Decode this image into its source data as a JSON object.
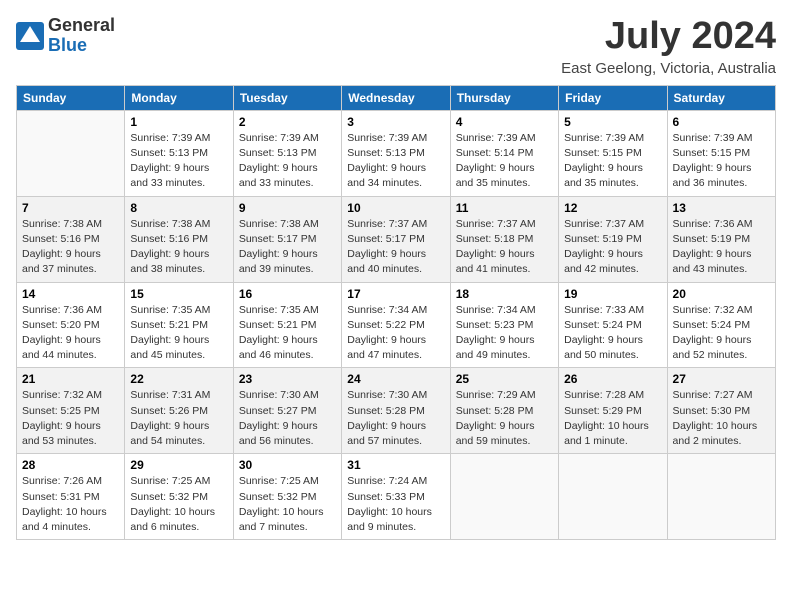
{
  "header": {
    "logo_line1": "General",
    "logo_line2": "Blue",
    "month_year": "July 2024",
    "location": "East Geelong, Victoria, Australia"
  },
  "days_of_week": [
    "Sunday",
    "Monday",
    "Tuesday",
    "Wednesday",
    "Thursday",
    "Friday",
    "Saturday"
  ],
  "weeks": [
    [
      {
        "day": "",
        "info": ""
      },
      {
        "day": "1",
        "info": "Sunrise: 7:39 AM\nSunset: 5:13 PM\nDaylight: 9 hours\nand 33 minutes."
      },
      {
        "day": "2",
        "info": "Sunrise: 7:39 AM\nSunset: 5:13 PM\nDaylight: 9 hours\nand 33 minutes."
      },
      {
        "day": "3",
        "info": "Sunrise: 7:39 AM\nSunset: 5:13 PM\nDaylight: 9 hours\nand 34 minutes."
      },
      {
        "day": "4",
        "info": "Sunrise: 7:39 AM\nSunset: 5:14 PM\nDaylight: 9 hours\nand 35 minutes."
      },
      {
        "day": "5",
        "info": "Sunrise: 7:39 AM\nSunset: 5:15 PM\nDaylight: 9 hours\nand 35 minutes."
      },
      {
        "day": "6",
        "info": "Sunrise: 7:39 AM\nSunset: 5:15 PM\nDaylight: 9 hours\nand 36 minutes."
      }
    ],
    [
      {
        "day": "7",
        "info": "Sunrise: 7:38 AM\nSunset: 5:16 PM\nDaylight: 9 hours\nand 37 minutes."
      },
      {
        "day": "8",
        "info": "Sunrise: 7:38 AM\nSunset: 5:16 PM\nDaylight: 9 hours\nand 38 minutes."
      },
      {
        "day": "9",
        "info": "Sunrise: 7:38 AM\nSunset: 5:17 PM\nDaylight: 9 hours\nand 39 minutes."
      },
      {
        "day": "10",
        "info": "Sunrise: 7:37 AM\nSunset: 5:17 PM\nDaylight: 9 hours\nand 40 minutes."
      },
      {
        "day": "11",
        "info": "Sunrise: 7:37 AM\nSunset: 5:18 PM\nDaylight: 9 hours\nand 41 minutes."
      },
      {
        "day": "12",
        "info": "Sunrise: 7:37 AM\nSunset: 5:19 PM\nDaylight: 9 hours\nand 42 minutes."
      },
      {
        "day": "13",
        "info": "Sunrise: 7:36 AM\nSunset: 5:19 PM\nDaylight: 9 hours\nand 43 minutes."
      }
    ],
    [
      {
        "day": "14",
        "info": "Sunrise: 7:36 AM\nSunset: 5:20 PM\nDaylight: 9 hours\nand 44 minutes."
      },
      {
        "day": "15",
        "info": "Sunrise: 7:35 AM\nSunset: 5:21 PM\nDaylight: 9 hours\nand 45 minutes."
      },
      {
        "day": "16",
        "info": "Sunrise: 7:35 AM\nSunset: 5:21 PM\nDaylight: 9 hours\nand 46 minutes."
      },
      {
        "day": "17",
        "info": "Sunrise: 7:34 AM\nSunset: 5:22 PM\nDaylight: 9 hours\nand 47 minutes."
      },
      {
        "day": "18",
        "info": "Sunrise: 7:34 AM\nSunset: 5:23 PM\nDaylight: 9 hours\nand 49 minutes."
      },
      {
        "day": "19",
        "info": "Sunrise: 7:33 AM\nSunset: 5:24 PM\nDaylight: 9 hours\nand 50 minutes."
      },
      {
        "day": "20",
        "info": "Sunrise: 7:32 AM\nSunset: 5:24 PM\nDaylight: 9 hours\nand 52 minutes."
      }
    ],
    [
      {
        "day": "21",
        "info": "Sunrise: 7:32 AM\nSunset: 5:25 PM\nDaylight: 9 hours\nand 53 minutes."
      },
      {
        "day": "22",
        "info": "Sunrise: 7:31 AM\nSunset: 5:26 PM\nDaylight: 9 hours\nand 54 minutes."
      },
      {
        "day": "23",
        "info": "Sunrise: 7:30 AM\nSunset: 5:27 PM\nDaylight: 9 hours\nand 56 minutes."
      },
      {
        "day": "24",
        "info": "Sunrise: 7:30 AM\nSunset: 5:28 PM\nDaylight: 9 hours\nand 57 minutes."
      },
      {
        "day": "25",
        "info": "Sunrise: 7:29 AM\nSunset: 5:28 PM\nDaylight: 9 hours\nand 59 minutes."
      },
      {
        "day": "26",
        "info": "Sunrise: 7:28 AM\nSunset: 5:29 PM\nDaylight: 10 hours\nand 1 minute."
      },
      {
        "day": "27",
        "info": "Sunrise: 7:27 AM\nSunset: 5:30 PM\nDaylight: 10 hours\nand 2 minutes."
      }
    ],
    [
      {
        "day": "28",
        "info": "Sunrise: 7:26 AM\nSunset: 5:31 PM\nDaylight: 10 hours\nand 4 minutes."
      },
      {
        "day": "29",
        "info": "Sunrise: 7:25 AM\nSunset: 5:32 PM\nDaylight: 10 hours\nand 6 minutes."
      },
      {
        "day": "30",
        "info": "Sunrise: 7:25 AM\nSunset: 5:32 PM\nDaylight: 10 hours\nand 7 minutes."
      },
      {
        "day": "31",
        "info": "Sunrise: 7:24 AM\nSunset: 5:33 PM\nDaylight: 10 hours\nand 9 minutes."
      },
      {
        "day": "",
        "info": ""
      },
      {
        "day": "",
        "info": ""
      },
      {
        "day": "",
        "info": ""
      }
    ]
  ]
}
